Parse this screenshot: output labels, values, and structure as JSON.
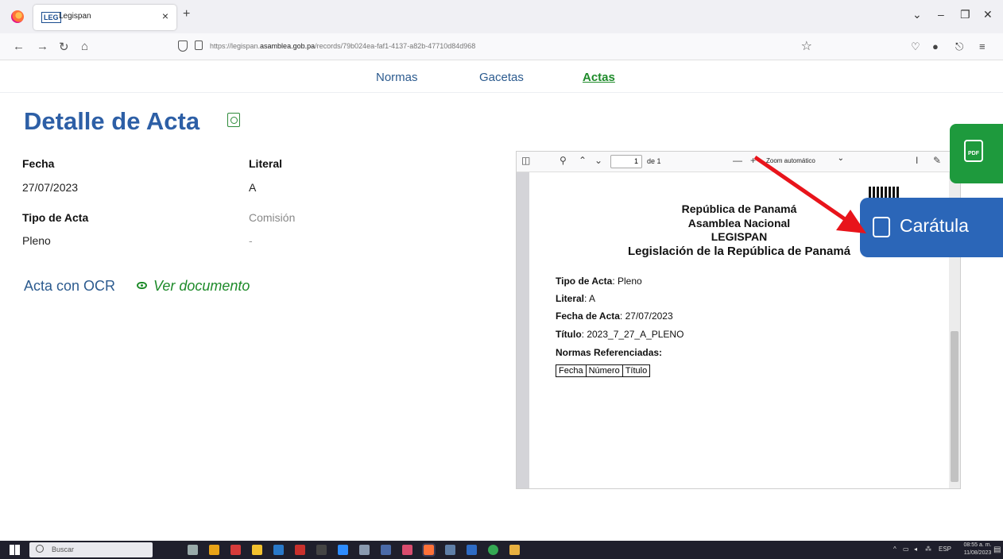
{
  "browser": {
    "tab_title": "Legispan",
    "tab_favicon": "LEG",
    "new_tab": "+",
    "url_host_prefix": "https://legispan.",
    "url_host": "asamblea.gob.pa",
    "url_path": "/records/79b024ea-faf1-4137-a82b-47710d84d968"
  },
  "sitenav": {
    "items": [
      {
        "label": "Normas"
      },
      {
        "label": "Gacetas"
      },
      {
        "label": "Actas"
      }
    ]
  },
  "page": {
    "title": "Detalle de Acta",
    "fields": {
      "fecha_label": "Fecha",
      "fecha_value": "27/07/2023",
      "literal_label": "Literal",
      "literal_value": "A",
      "tipo_label": "Tipo de Acta",
      "tipo_value": "Pleno",
      "comision_label": "Comisión",
      "comision_value": "-"
    },
    "ocr_label": "Acta con OCR",
    "ver_documento": "Ver documento"
  },
  "pdf": {
    "page_number": "1",
    "page_of": "de 1",
    "zoom": "Zoom automático",
    "heading": [
      "República de Panamá",
      "Asamblea Nacional",
      "LEGISPAN",
      "Legislación de la República de Panamá"
    ],
    "lines": [
      {
        "label": "Tipo de Acta",
        "value": "Pleno"
      },
      {
        "label": "Literal",
        "value": "A"
      },
      {
        "label": "Fecha de Acta",
        "value": "27/07/2023"
      },
      {
        "label": "Título",
        "value": "2023_7_27_A_PLENO"
      }
    ],
    "normas_label": "Normas Referenciadas:",
    "table_headers": [
      "Fecha",
      "Número",
      "Título"
    ]
  },
  "floating": {
    "caratula": "Carátula",
    "pdf_icon": "PDF"
  },
  "taskbar": {
    "search": "Buscar",
    "lang": "ESP",
    "time": "08:55 a. m.",
    "date": "11/08/2023"
  },
  "colors": {
    "title_blue": "#2d5fa6",
    "active_green": "#1e8b2a",
    "pdf_button_green": "#1e9a3d",
    "caratula_blue": "#2b66b8",
    "arrow_red": "#e8141b"
  }
}
